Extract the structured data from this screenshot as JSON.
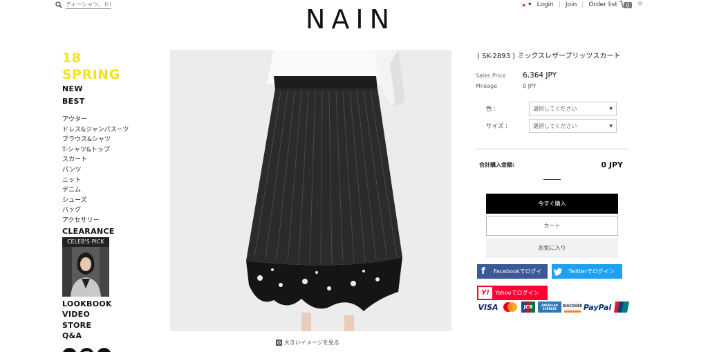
{
  "header": {
    "search_placeholder": "ティーシャツ、ドレ",
    "logo_text": "NAIN",
    "links": [
      "Login",
      "Join",
      "Order list"
    ],
    "cart_count": "0"
  },
  "nav": {
    "season": "18 SPRING",
    "top_links": [
      "NEW",
      "BEST"
    ],
    "categories": [
      "アウター",
      "ドレス&ジャンパスーツ",
      "ブラウス&シャツ",
      "T-シャツ&トップ",
      "スカート",
      "パンツ",
      "ニット",
      "デニム",
      "シューズ",
      "バッグ",
      "アクセサリー"
    ],
    "clearance": "CLEARANCE",
    "celeb_label": "CELEB'S PICK",
    "bottom_links": [
      "LOOKBOOK",
      "VIDEO",
      "STORE",
      "Q&A"
    ],
    "social_icons": [
      "facebook-icon",
      "instagram-icon",
      "nain-icon"
    ]
  },
  "product": {
    "zoom_label": "大きいイメージを見る",
    "title": "( SK-2893 ) ミックスレザープリッツスカート",
    "sales_price_label": "Sales Price",
    "sales_price": "6,364 JPY",
    "mileage_label": "Mileage",
    "mileage": "0 JPY",
    "options": [
      {
        "label": "色 :",
        "value": "選択してください"
      },
      {
        "label": "サイズ :",
        "value": "選択してください"
      }
    ],
    "total_label": "合計購入金額:",
    "total_value": "0 JPY",
    "buy_now": "今すぐ購入",
    "cart": "カート",
    "favorite": "お気に入り",
    "facebook_login": "Facebookでログイ",
    "twitter_login": "Twitterでログイン",
    "yahoo_login": "Yahooでログイン",
    "payment_icons": [
      "VISA",
      "mastercard-icon",
      "JCB",
      "AMERICAN EXPRESS",
      "DISCOVER",
      "PayPal",
      "unionpay-icon"
    ]
  },
  "colors": {
    "season": "#f5e31c",
    "facebook": "#3b5998",
    "twitter": "#1da1f2",
    "yahoo": "#ff0033"
  }
}
